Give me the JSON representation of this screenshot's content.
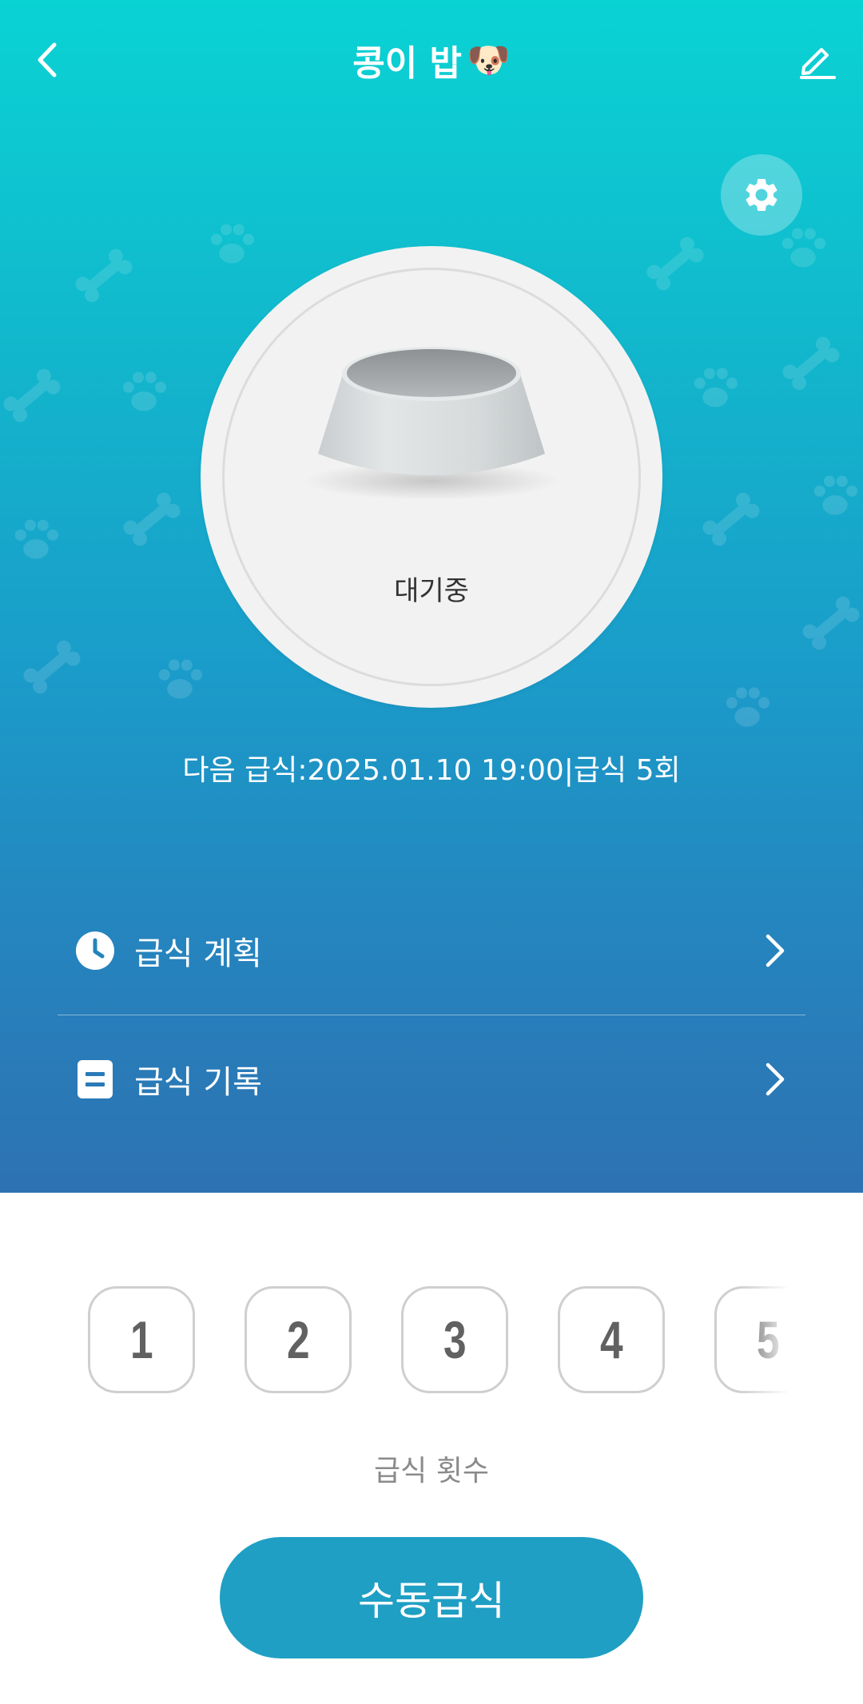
{
  "header": {
    "title": "콩이 밥",
    "title_emoji": "🐶",
    "back_icon": "chevron-left-icon",
    "edit_icon": "pencil-icon"
  },
  "settings": {
    "icon": "gear-icon"
  },
  "bowl": {
    "status": "대기중"
  },
  "next_feeding": {
    "text": "다음 급식:2025.01.10 19:00|급식 5회"
  },
  "menu": [
    {
      "label": "급식 계획",
      "icon": "clock-icon"
    },
    {
      "label": "급식 기록",
      "icon": "document-icon"
    }
  ],
  "feeding_count": {
    "options": [
      "1",
      "2",
      "3",
      "4",
      "5"
    ],
    "label": "급식 횟수"
  },
  "manual_feed_button": {
    "label": "수동급식"
  },
  "colors": {
    "gradient_top": "#0ad3d4",
    "gradient_bottom": "#2d72b2",
    "button": "#1f9fc4",
    "text_dark": "#333333",
    "text_gray": "#8a8a8a"
  }
}
